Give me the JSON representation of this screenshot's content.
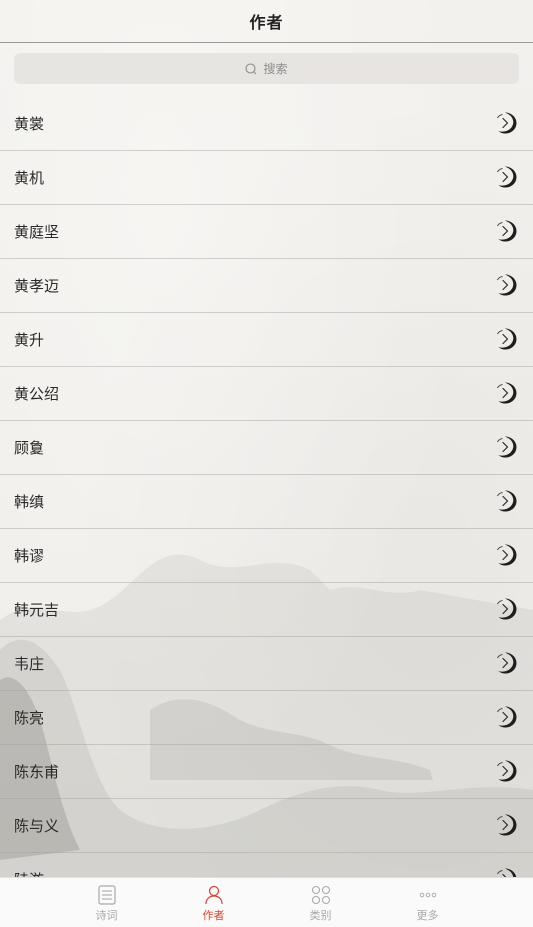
{
  "header": {
    "title": "作者"
  },
  "search": {
    "placeholder": "搜索"
  },
  "authors": [
    "黄裳",
    "黄机",
    "黄庭坚",
    "黄孝迈",
    "黄升",
    "黄公绍",
    "顾敻",
    "韩缜",
    "韩谬",
    "韩元吉",
    "韦庄",
    "陈亮",
    "陈东甫",
    "陈与义",
    "陆游"
  ],
  "tabbar": {
    "tabs": [
      {
        "label": "诗词",
        "icon": "document-icon",
        "active": false
      },
      {
        "label": "作者",
        "icon": "person-icon",
        "active": true
      },
      {
        "label": "类别",
        "icon": "grid-icon",
        "active": false
      },
      {
        "label": "更多",
        "icon": "more-dots-icon",
        "active": false
      }
    ]
  },
  "colors": {
    "accent": "#d9432f",
    "inactive": "#a9a9a9"
  }
}
